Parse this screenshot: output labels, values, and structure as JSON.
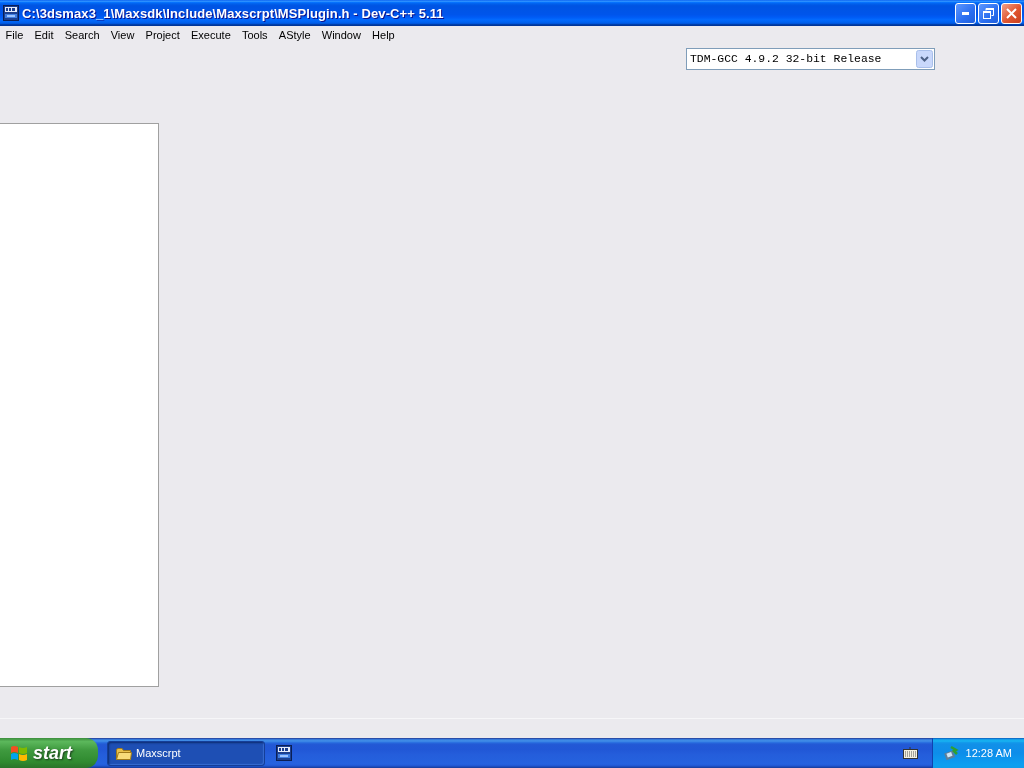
{
  "window": {
    "title": "C:\\3dsmax3_1\\Maxsdk\\Include\\Maxscrpt\\MSPlugin.h - Dev-C++ 5.11"
  },
  "menu": [
    "File",
    "Edit",
    "Search",
    "View",
    "Project",
    "Execute",
    "Tools",
    "AStyle",
    "Window",
    "Help"
  ],
  "toolbar": {
    "compiler": "TDM-GCC 4.9.2 32-bit Release"
  },
  "taskbar": {
    "start": "start",
    "tasks": [
      {
        "label": "Maxscrpt",
        "selected": true
      }
    ],
    "clock": "12:28 AM"
  }
}
